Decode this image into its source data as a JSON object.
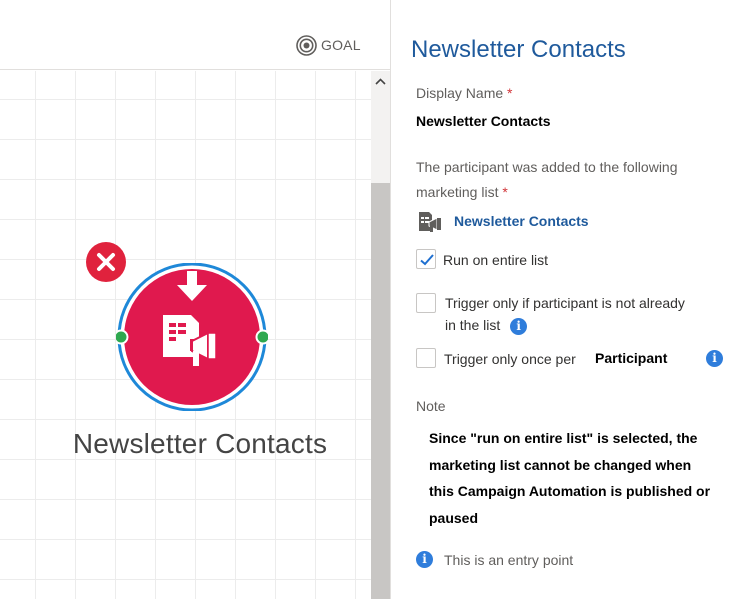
{
  "toolbar": {
    "goal_label": "GOAL",
    "goal_icon": "target-icon"
  },
  "node": {
    "title": "Newsletter Contacts",
    "icon": "marketing-list-icon",
    "color": "#e0194e",
    "ring_color": "#1e88d8",
    "connector_color": "#2fa84f",
    "delete_icon": "close-icon"
  },
  "panel": {
    "title": "Newsletter Contacts",
    "display_name_label": "Display Name",
    "required_mark": "*",
    "display_name_value": "Newsletter Contacts",
    "list_label_line1": "The participant was added to the following",
    "list_label_line2": "marketing list",
    "list_link": "Newsletter Contacts",
    "run_entire_list_label": "Run on entire list",
    "run_entire_list_checked": true,
    "trigger_not_in_list_line1": "Trigger only if participant is not already",
    "trigger_not_in_list_line2": "in the list",
    "trigger_not_in_list_checked": false,
    "trigger_once_label": "Trigger only once per",
    "trigger_once_value": "Participant",
    "trigger_once_checked": false,
    "note_label": "Note",
    "note_text": "Since \"run on entire list\" is selected, the marketing list cannot be changed when this Campaign Automation is published or paused",
    "entry_point_text": "This is an entry point",
    "info_glyph": "i",
    "accent_color": "#1f5a9c"
  }
}
